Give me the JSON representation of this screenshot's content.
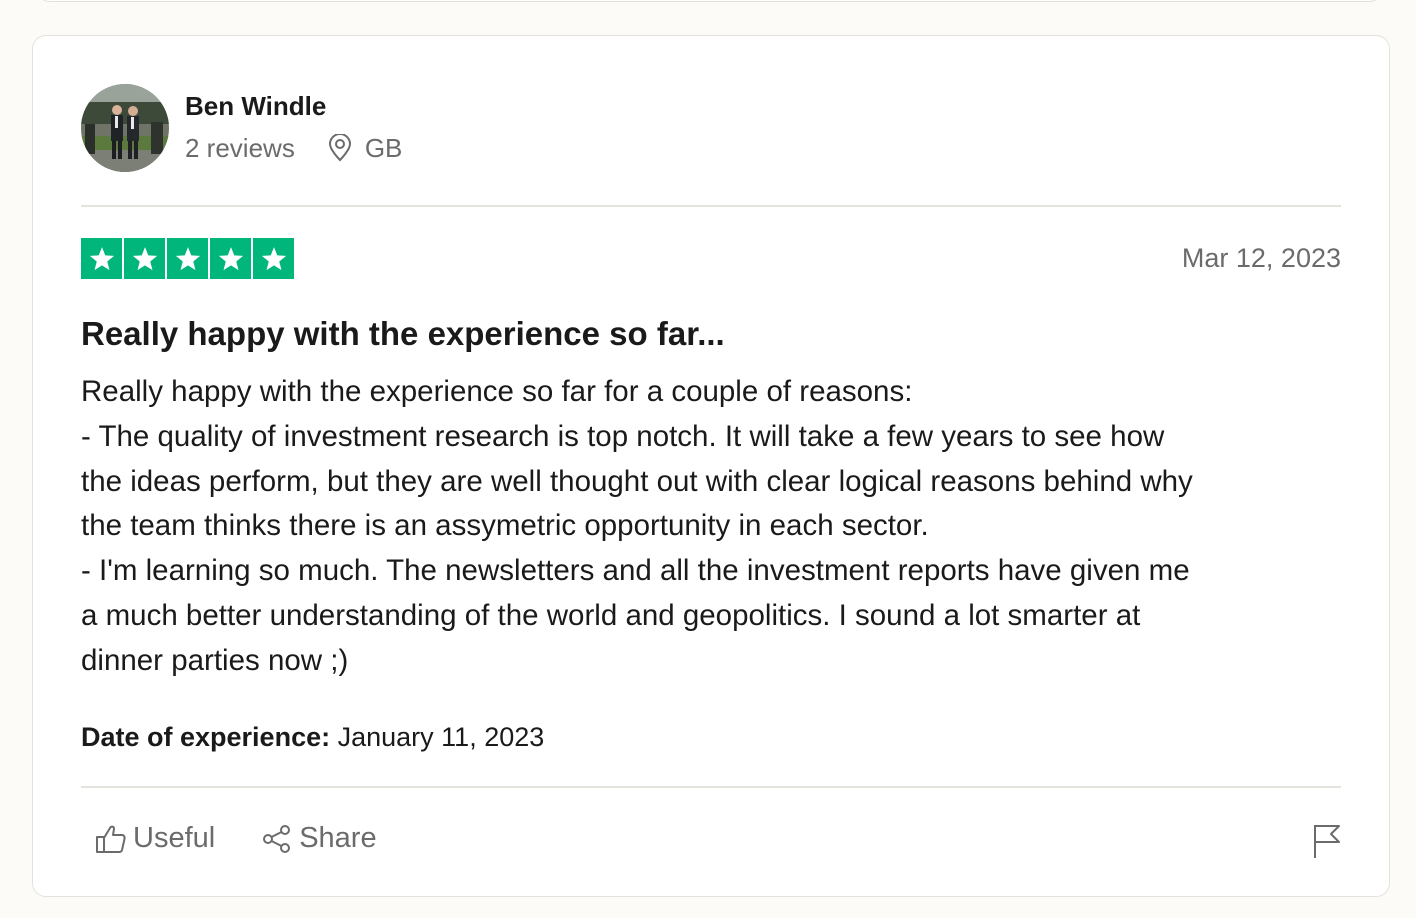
{
  "reviewer": {
    "name": "Ben Windle",
    "reviews_count": "2 reviews",
    "country": "GB"
  },
  "review": {
    "rating": 5,
    "rating_max": 5,
    "date": "Mar 12, 2023",
    "title": "Really happy with the experience so far...",
    "body_lines": [
      "Really happy with the experience so far for a couple of reasons:",
      "- The quality of investment research is top notch. It will take a few years to see how",
      "the ideas perform, but they are well thought out with clear logical reasons behind why",
      "the team thinks there is an assymetric opportunity in each sector.",
      "- I'm learning so much. The newsletters and all the investment reports have given me",
      "a much better understanding of the world and geopolitics. I sound a lot smarter at",
      "dinner parties now ;)"
    ],
    "experience_label": "Date of experience:",
    "experience_date": "January 11, 2023"
  },
  "actions": {
    "useful_label": "Useful",
    "share_label": "Share"
  },
  "icons": {
    "location": "map-pin-icon",
    "useful": "thumbs-up-icon",
    "share": "share-icon",
    "flag": "flag-icon",
    "star": "star-icon"
  },
  "colors": {
    "star_green": "#00b67a",
    "muted_text": "#6b6b6b",
    "card_border": "#e3e1db",
    "page_background": "#fcfbf7"
  }
}
